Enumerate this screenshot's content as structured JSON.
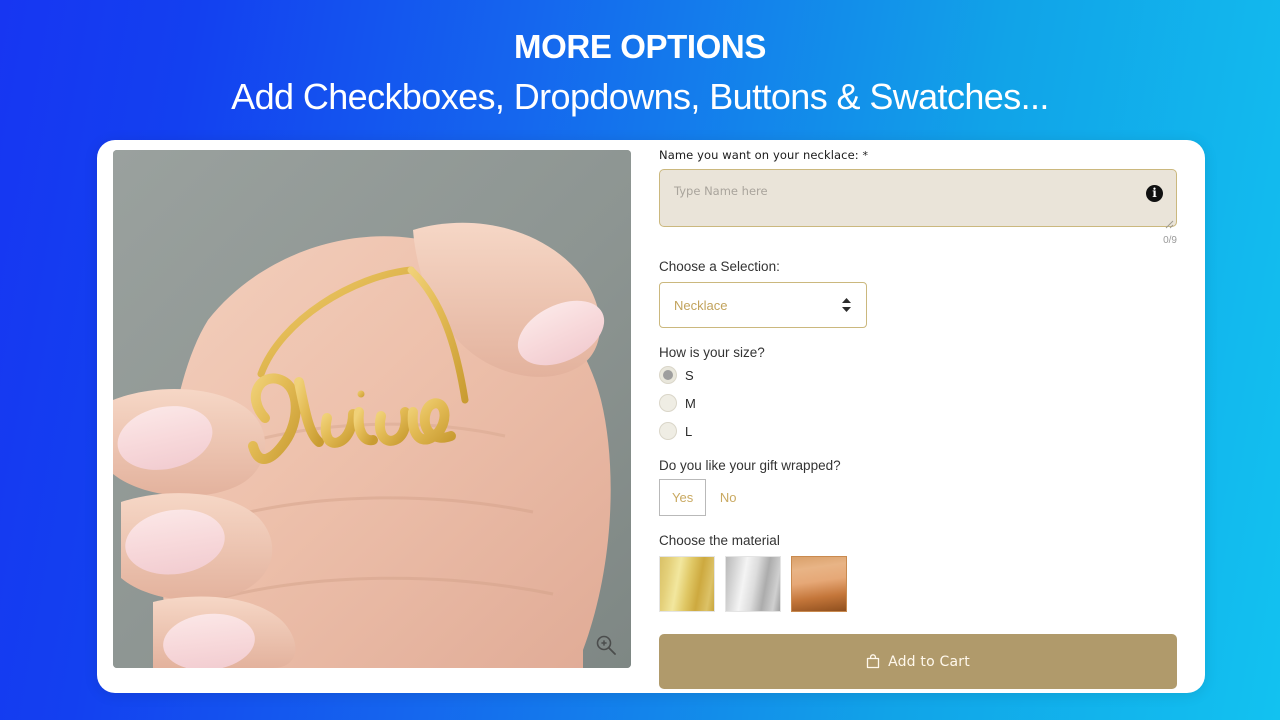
{
  "header": {
    "title": "MORE OPTIONS",
    "subtitle": "Add Checkboxes, Dropdowns, Buttons & Swatches..."
  },
  "colors": {
    "bg_gradient_start": "#1736F2",
    "bg_gradient_end": "#12C2F0",
    "card_bg": "#FFFFFF",
    "accent_gold": "#C2A35C",
    "field_bg": "#EAE4D9",
    "field_border": "#CBB87E",
    "cart_button_bg": "#B09A6B",
    "image_bg": "#8F9794"
  },
  "product_image": {
    "alt": "Hand holding a gold script name necklace reading Olivia",
    "necklace_name": "Olivia",
    "zoom_icon": "magnifier-plus-icon"
  },
  "form": {
    "name_field": {
      "label": "Name you want on your necklace:",
      "required_marker": "*",
      "placeholder": "Type Name here",
      "value": "",
      "info_icon": "info-icon",
      "info_glyph": "i",
      "counter": "0/9"
    },
    "selection": {
      "label": "Choose a Selection:",
      "selected": "Necklace",
      "options": [
        "Necklace"
      ],
      "stepper_icon": "up-down-chevron-icon"
    },
    "size": {
      "label": "How is your size?",
      "options": [
        {
          "label": "S",
          "checked": true
        },
        {
          "label": "M",
          "checked": false
        },
        {
          "label": "L",
          "checked": false
        }
      ]
    },
    "gift_wrap": {
      "label": "Do you like your gift wrapped?",
      "options": [
        {
          "label": "Yes",
          "selected": true
        },
        {
          "label": "No",
          "selected": false
        }
      ]
    },
    "material": {
      "label": "Choose the material",
      "swatches": [
        {
          "name": "gold",
          "selected": false
        },
        {
          "name": "silver",
          "selected": false
        },
        {
          "name": "rose-gold",
          "selected": false
        }
      ]
    },
    "cart_button": {
      "label": "Add to Cart",
      "icon": "shopping-bag-icon"
    }
  }
}
